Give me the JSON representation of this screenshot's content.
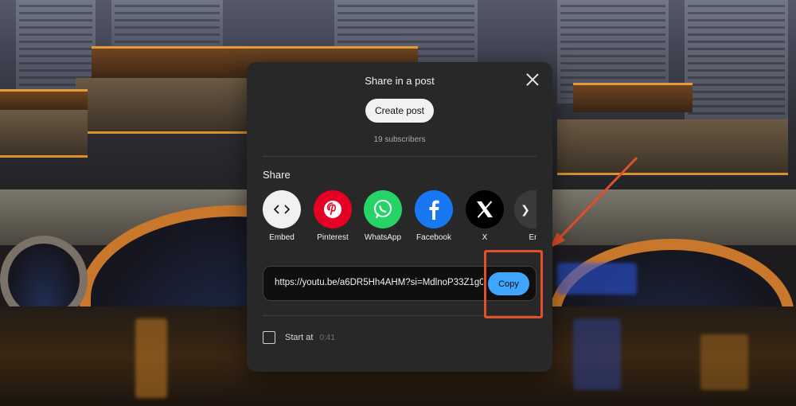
{
  "dialog": {
    "title": "Share in a post",
    "create_post_label": "Create post",
    "subscribers": "19 subscribers",
    "share_heading": "Share",
    "targets": [
      {
        "label": "Embed",
        "icon": "embed-icon",
        "color": "#f1f1f1"
      },
      {
        "label": "Pinterest",
        "icon": "pinterest-icon",
        "color": "#e60023"
      },
      {
        "label": "WhatsApp",
        "icon": "whatsapp-icon",
        "color": "#25d366"
      },
      {
        "label": "Facebook",
        "icon": "facebook-icon",
        "color": "#1877f2"
      },
      {
        "label": "X",
        "icon": "x-icon",
        "color": "#000000"
      },
      {
        "label": "Em",
        "icon": "email-icon",
        "color": "#888888"
      }
    ],
    "url": "https://youtu.be/a6DR5Hh4AHM?si=MdlnoP33Z1g0",
    "copy_label": "Copy",
    "start_at_label": "Start at",
    "start_at_time": "0:41"
  },
  "colors": {
    "accent": "#3ea6ff",
    "annotation": "#e2502a",
    "dialog_bg": "#282828"
  }
}
